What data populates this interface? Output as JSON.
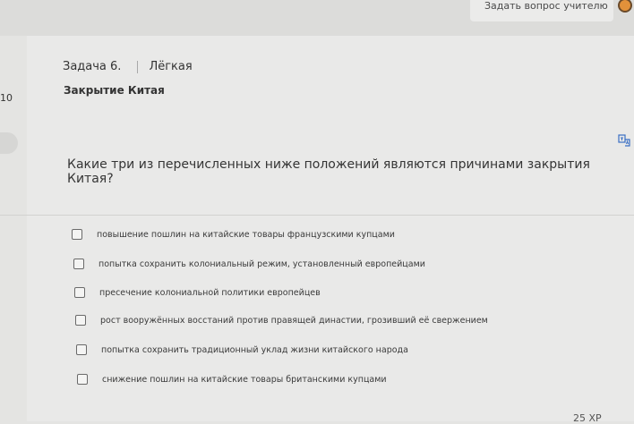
{
  "header": {
    "ask_teacher": "Задать вопрос учителю"
  },
  "sidebar": {
    "number": "10"
  },
  "task": {
    "number": "Задача 6.",
    "difficulty": "Лёгкая",
    "title": "Закрытие Китая"
  },
  "question": "Какие три из перечисленных ниже положений являются причинами закрытия Китая?",
  "options": [
    {
      "label": "повышение пошлин на китайские товары французскими купцами",
      "checked": false
    },
    {
      "label": "попытка сохранить колониальный режим, установленный европейцами",
      "checked": false
    },
    {
      "label": "пресечение колониальной политики европейцев",
      "checked": false
    },
    {
      "label": "рост вооружённых восстаний против правящей династии, грозивший её свержением",
      "checked": false
    },
    {
      "label": "попытка сохранить традиционный уклад жизни китайского народа",
      "checked": false
    },
    {
      "label": "снижение пошлин на китайские товары британскими купцами",
      "checked": false
    }
  ],
  "footer": {
    "xp": "25 XP"
  },
  "colors": {
    "background": "#e4e4e2",
    "card": "#e9e9e8",
    "text": "#333333",
    "accent_icon": "#3a6fc4"
  }
}
